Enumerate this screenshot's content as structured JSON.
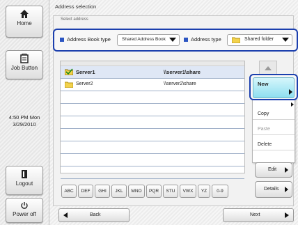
{
  "sidebar": {
    "home_label": "Home",
    "job_button_label": "Job Button",
    "clock_time": "4:50 PM  Mon",
    "clock_date": "3/29/2010",
    "logout_label": "Logout",
    "power_label": "Power off"
  },
  "header": {
    "title": "Address selection",
    "panel_label": "Select address"
  },
  "filters": {
    "address_book_type_label": "Address Book type",
    "address_book_type_value": "Shared Address Book",
    "address_type_label": "Address type",
    "address_type_value": "Shared folder"
  },
  "list": {
    "rows": [
      {
        "name": "Server1",
        "path": "\\\\server1\\share",
        "selected": true
      },
      {
        "name": "Server2",
        "path": "\\\\server2\\share",
        "selected": false
      }
    ]
  },
  "menu": {
    "new_label": "New",
    "copy_label": "Copy",
    "paste_label": "Paste",
    "delete_label": "Delete"
  },
  "right_buttons": {
    "edit_label": "Edit",
    "details_label": "Details"
  },
  "alpha_tabs": [
    "ABC",
    "DEF",
    "GHI",
    "JKL",
    "MNO",
    "PQR",
    "STU",
    "VWX",
    "YZ",
    "0-9"
  ],
  "nav": {
    "back_label": "Back",
    "next_label": "Next"
  }
}
